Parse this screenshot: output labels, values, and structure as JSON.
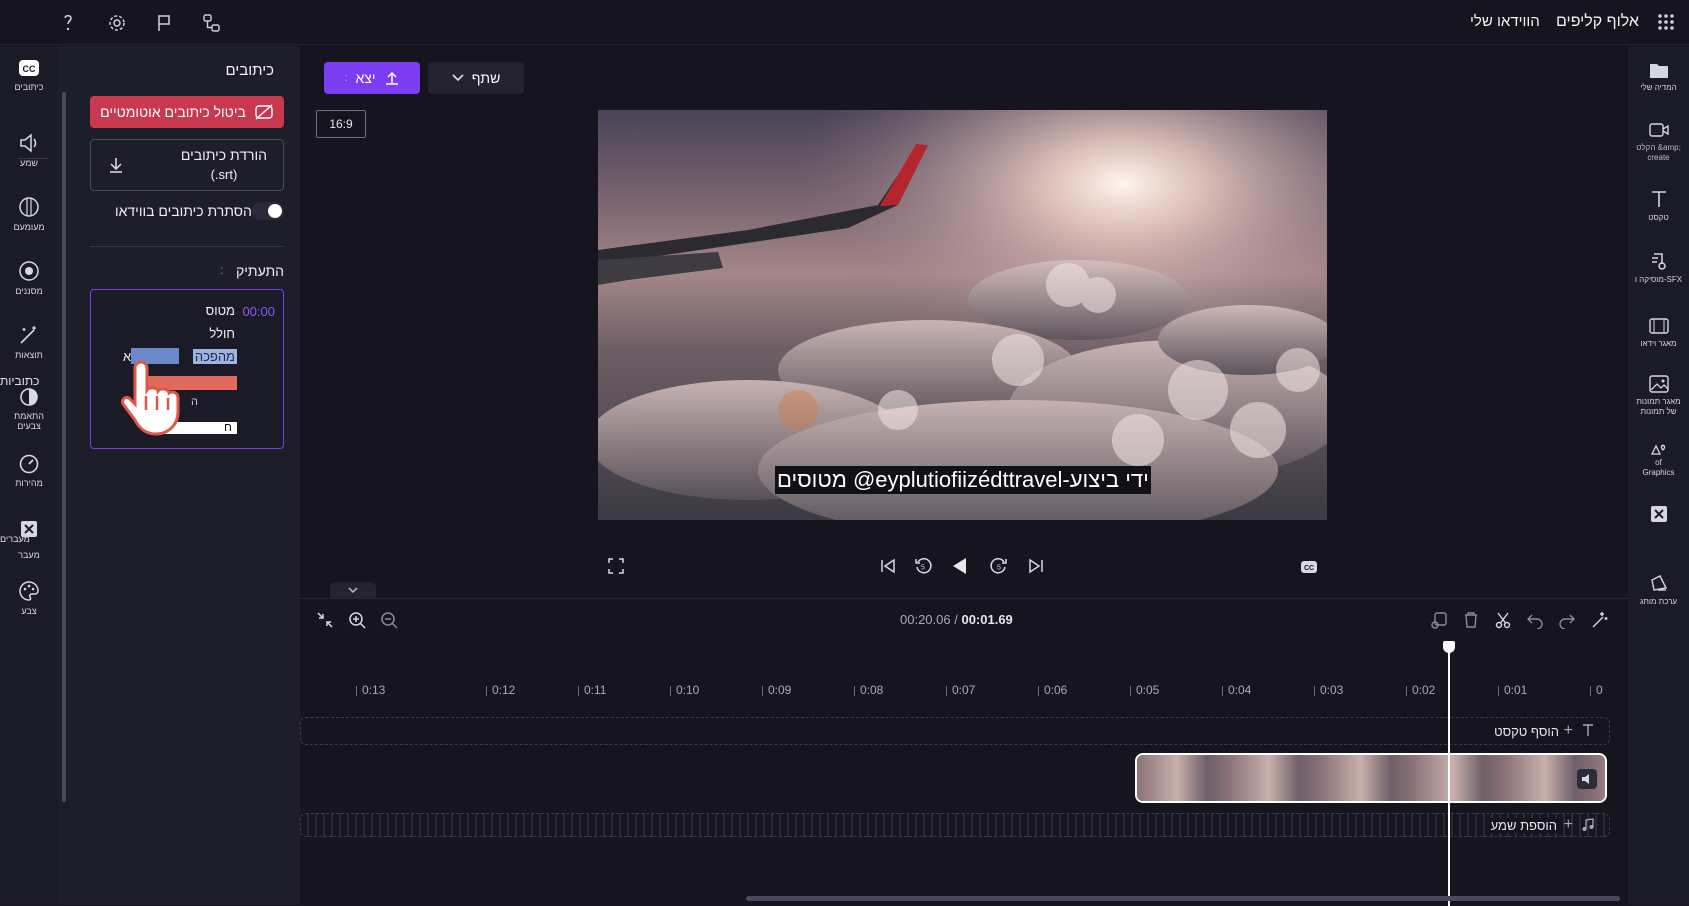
{
  "topbar": {
    "app_name": "אלוף קליפים",
    "my_videos": "הווידאו שלי"
  },
  "left_rail": {
    "items": [
      {
        "label": "כיתובים",
        "icon": "cc-icon"
      },
      {
        "label": "שמע",
        "icon": "speaker-icon"
      },
      {
        "label": "מעומעם",
        "icon": "fade-icon"
      },
      {
        "label": "מסננים",
        "icon": "filters-icon"
      },
      {
        "label": "תוצאות",
        "icon": "magic-wand-icon"
      },
      {
        "label": "התאמת צבעים",
        "icon": "contrast-icon"
      },
      {
        "label": "מהירות",
        "icon": "speed-icon"
      },
      {
        "label": "מעבר",
        "icon": "transition-icon"
      },
      {
        "label": "צבע",
        "icon": "palette-icon"
      }
    ],
    "overflow_label_1": "כתוביות",
    "overflow_label_2": "מעברים"
  },
  "captions_panel": {
    "title": "כיתובים",
    "disable_auto_captions": "ביטול כיתובים אוטומטיים",
    "download_captions_line1": "הורדת כיתובים",
    "download_captions_line2": "(.srt)",
    "hide_captions_toggle": "הסתרת כיתובים בווידאו",
    "transcript_title": "התעתיק",
    "transcript_colon": ":",
    "transcript": {
      "timestamp": "00:00",
      "line1": "מטוס",
      "line2": "חולל",
      "line3": "מהפכה",
      "line3_extra": "א",
      "line4": "ה",
      "line5": "ח"
    }
  },
  "center": {
    "export_label": "יצא",
    "share_label": "שתף",
    "aspect_ratio": "16:9",
    "caption_overlay": "מטוסים @eyplutiofiizédttravel-ידי ביצוע"
  },
  "timeline": {
    "time_current": "00:01.69",
    "time_total": "00:20.06",
    "ticks": [
      "0",
      "0:01",
      "0:02",
      "0:03",
      "0:04",
      "0:05",
      "0:06",
      "0:07",
      "0:08",
      "0:09",
      "0:10",
      "0:11",
      "0:12",
      "0:13"
    ],
    "add_text": "הוסף טקסט",
    "add_audio": "הוספת שמע"
  },
  "right_rail": {
    "items": [
      {
        "label": "המדיה שלי",
        "icon": "folder-icon"
      },
      {
        "label": "הקלט &amp; create",
        "icon": "record-icon"
      },
      {
        "label": "טקסט",
        "icon": "text-icon"
      },
      {
        "label": "מוסיקה ו-SFX",
        "icon": "music-icon"
      },
      {
        "label": "מאגר וידאו",
        "icon": "video-library-icon"
      },
      {
        "label": "מאגר תמונות של תמונות",
        "icon": "image-icon"
      },
      {
        "label": "of Graphics",
        "icon": "shapes-icon"
      },
      {
        "label": "",
        "icon": "transitions-icon"
      },
      {
        "label": "ערכת מותג",
        "icon": "brand-kit-icon"
      }
    ]
  },
  "colors": {
    "accent": "#7b3cf2",
    "danger": "#c8384e",
    "bg": "#15141f",
    "panel": "#1e1d2a"
  }
}
